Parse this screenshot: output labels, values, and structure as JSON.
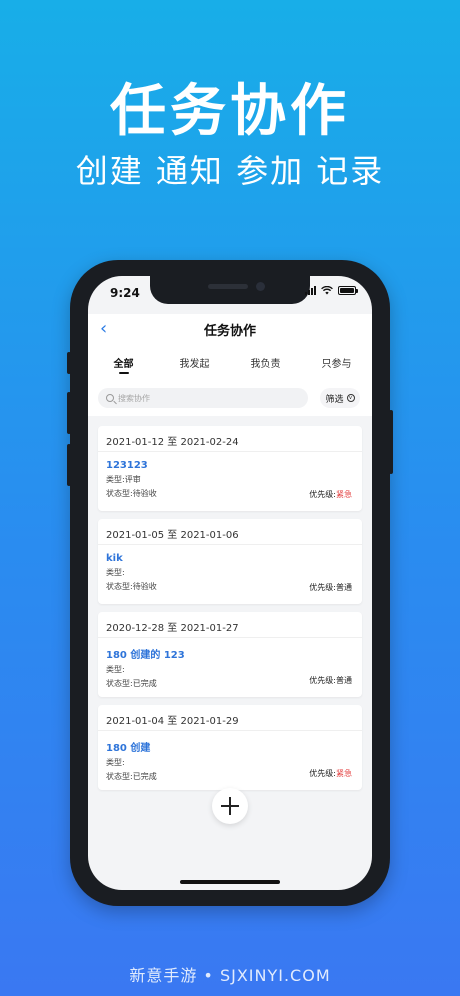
{
  "hero": {
    "title": "任务协作",
    "subtitle": "创建 通知 参加 记录"
  },
  "status": {
    "time": "9:24"
  },
  "nav": {
    "back": "‹",
    "title": "任务协作"
  },
  "tabs": [
    "全部",
    "我发起",
    "我负责",
    "只参与"
  ],
  "search": {
    "placeholder": "搜索协作",
    "filter_label": "筛选"
  },
  "colors": {
    "accent": "#2e74d9",
    "urgent": "#e33b3b"
  },
  "tasks": [
    {
      "date": "2021-01-12 至 2021-02-24",
      "name": "123123",
      "type": "类型:评审",
      "state": "状态型:待验收",
      "prio_label": "优先级:",
      "prio_value": "紧急",
      "urgent": true
    },
    {
      "date": "2021-01-05 至 2021-01-06",
      "name": "kik",
      "type": "类型:",
      "state": "状态型:待验收",
      "prio_label": "优先级:",
      "prio_value": "普通",
      "urgent": false
    },
    {
      "date": "2020-12-28 至 2021-01-27",
      "name": "180 创建的 123",
      "type": "类型:",
      "state": "状态型:已完成",
      "prio_label": "优先级:",
      "prio_value": "普通",
      "urgent": false
    },
    {
      "date": "2021-01-04 至 2021-01-29",
      "name": "180 创建",
      "type": "类型:",
      "state": "状态型:已完成",
      "prio_label": "优先级:",
      "prio_value": "紧急",
      "urgent": true
    }
  ],
  "watermark": "新意手游 • SJXINYI.COM"
}
